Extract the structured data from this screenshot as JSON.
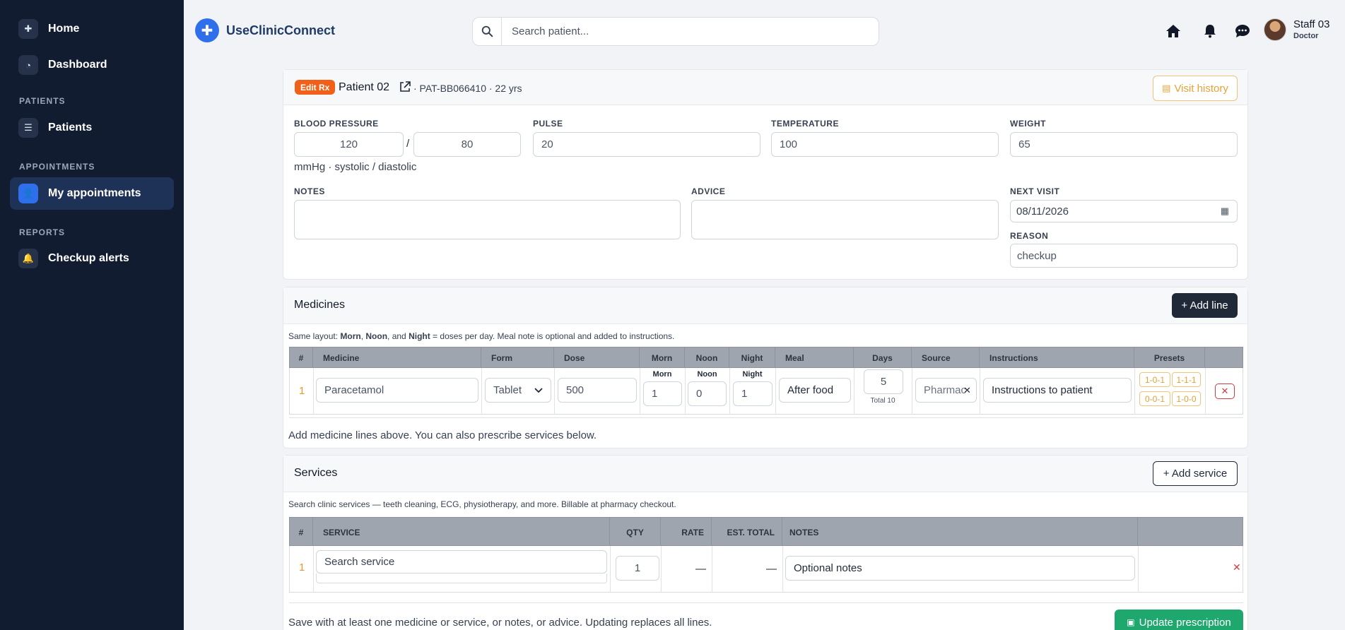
{
  "sidebar": {
    "items": [
      {
        "label": "Home",
        "icon": "plus-circle-icon"
      },
      {
        "label": "Dashboard",
        "icon": "pie-chart-icon"
      },
      {
        "label": "Patients",
        "icon": "list-icon"
      },
      {
        "label": "My appointments",
        "icon": "user-clock-icon"
      },
      {
        "label": "Checkup alerts",
        "icon": "bell-icon"
      }
    ],
    "sections": [
      "PATIENTS",
      "APPOINTMENTS",
      "REPORTS"
    ]
  },
  "header": {
    "brand": "UseClinicConnect",
    "search_placeholder": "Search patient...",
    "user_name": "Staff 03",
    "user_role": "Doctor"
  },
  "patient": {
    "badge": "Edit Rx",
    "name": "Patient 02",
    "meta": "· PAT-BB066410 · 22 yrs",
    "visit_history": "Visit history"
  },
  "vitals": {
    "bp_label": "BLOOD PRESSURE",
    "systolic": "120",
    "slash": "/",
    "diastolic": "80",
    "bp_unit": "mmHg · systolic / diastolic",
    "pulse_label": "PULSE",
    "pulse": "20",
    "temp_label": "TEMPERATURE",
    "temp": "100",
    "weight_label": "WEIGHT",
    "weight": "65",
    "notes_label": "NOTES",
    "advice_label": "ADVICE",
    "next_visit_label": "NEXT VISIT",
    "next_visit": "08/11/2026",
    "reason_label": "REASON",
    "reason": "checkup"
  },
  "medicines": {
    "title": "Medicines",
    "add_line": "+ Add line",
    "hint_pre": "Same layout: ",
    "hint_morn": "Morn",
    "hint_sep1": ", ",
    "hint_noon": "Noon",
    "hint_sep2": ", and ",
    "hint_night": "Night",
    "hint_post": " = doses per day. Meal note is optional and added to instructions.",
    "columns": [
      "#",
      "Medicine",
      "Form",
      "Dose",
      "Morn",
      "Noon",
      "Night",
      "Meal",
      "Days",
      "Source",
      "Instructions",
      "Presets"
    ],
    "row": {
      "num": "1",
      "medicine": "Paracetamol",
      "form": "Tablet",
      "dose": "500",
      "morn_lbl": "Morn",
      "morn": "1",
      "noon_lbl": "Noon",
      "noon": "0",
      "night_lbl": "Night",
      "night": "1",
      "meal": "After food",
      "days": "5",
      "total": "Total 10",
      "source": "Pharmac",
      "instructions": "Instructions to patient",
      "presets": [
        "1-0-1",
        "1-1-1",
        "0-0-1",
        "1-0-0"
      ]
    },
    "footer_note": "Add medicine lines above. You can also prescribe services below."
  },
  "services": {
    "title": "Services",
    "add_service": "+ Add service",
    "hint": "Search clinic services — teeth cleaning, ECG, physiotherapy, and more. Billable at pharmacy checkout.",
    "columns": [
      "#",
      "SERVICE",
      "QTY",
      "RATE",
      "EST. TOTAL",
      "NOTES"
    ],
    "row": {
      "num": "1",
      "service_placeholder": "Search service",
      "qty": "1",
      "rate": "—",
      "est_total": "—",
      "notes_placeholder": "Optional notes"
    },
    "footer_note": "Save with at least one medicine or service, or notes, or advice. Updating replaces all lines.",
    "update_btn": "Update prescription"
  },
  "colors": {
    "sidebar_bg": "#121c30",
    "accent": "#2f6feb",
    "badge": "#f06018",
    "success": "#1ea86e"
  }
}
